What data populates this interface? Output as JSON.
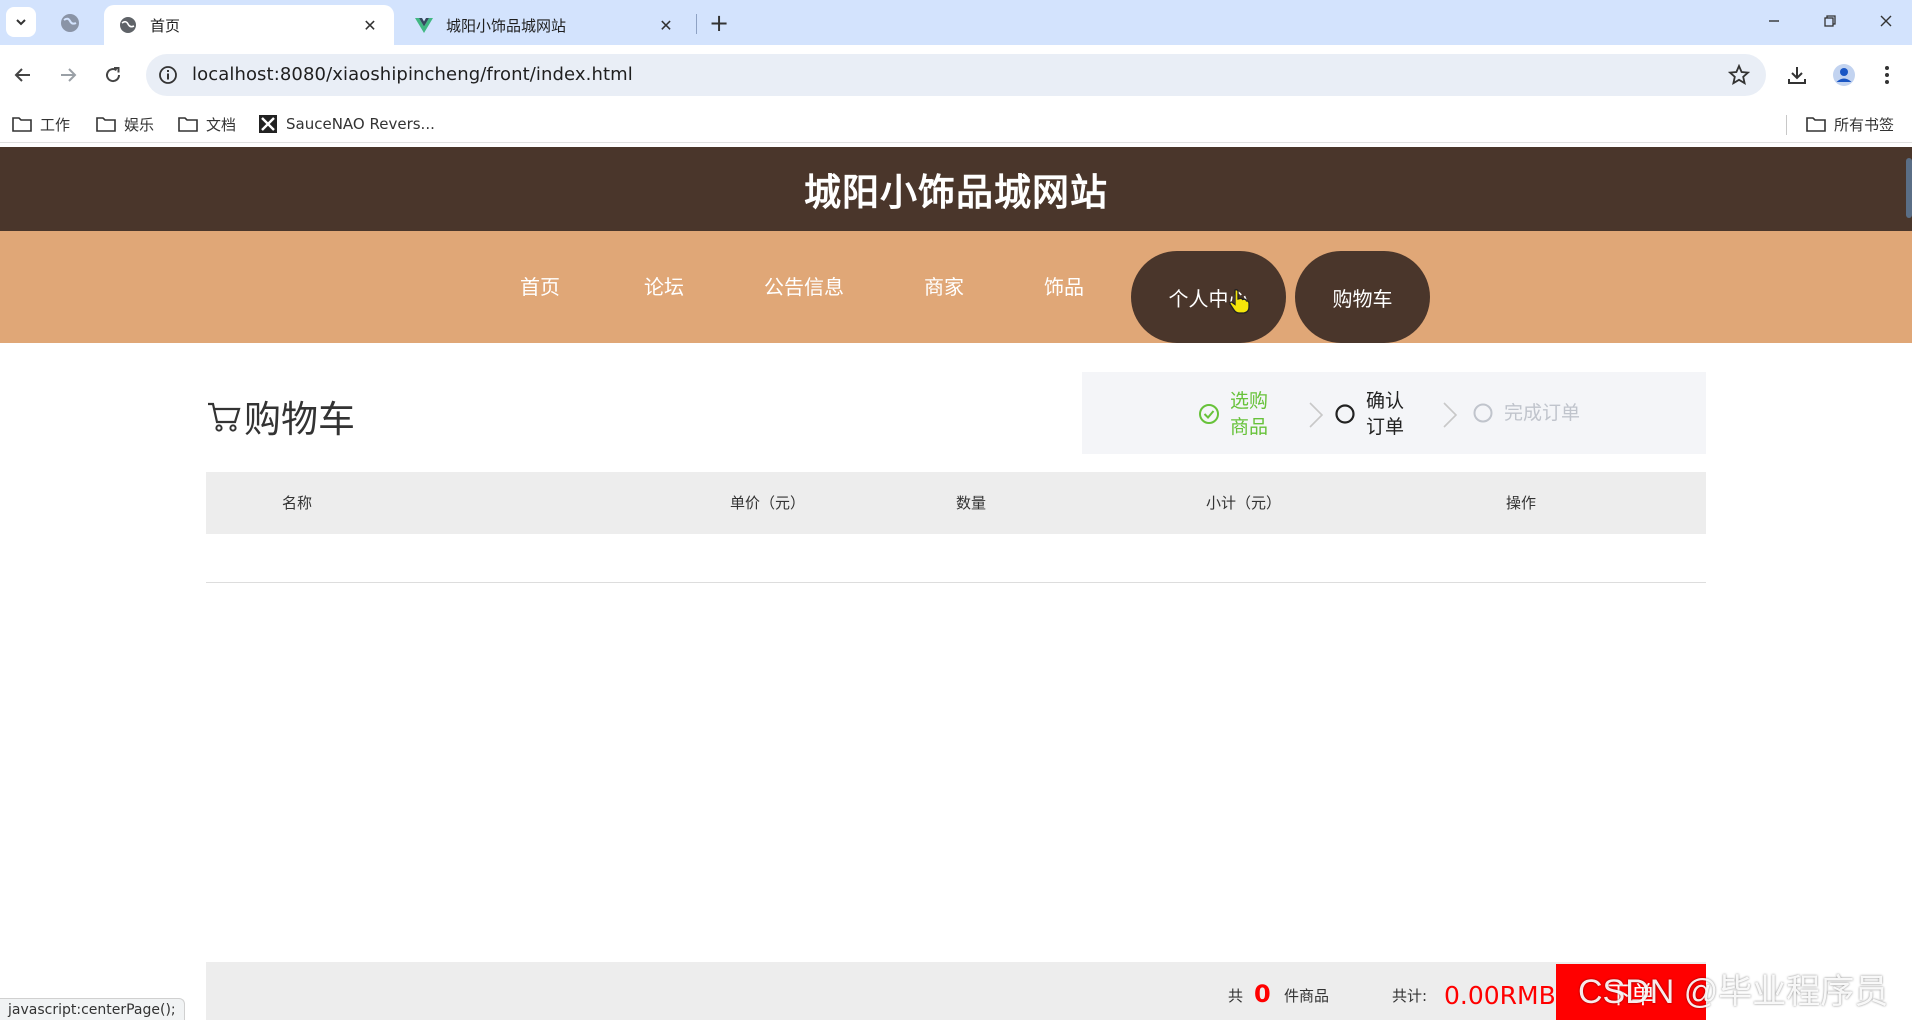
{
  "browser": {
    "tabs": [
      {
        "title": "首页",
        "active": true
      },
      {
        "title": "城阳小饰品城网站",
        "active": false
      }
    ],
    "url": "localhost:8080/xiaoshipincheng/front/index.html",
    "bookmarks": [
      {
        "label": "工作"
      },
      {
        "label": "娱乐"
      },
      {
        "label": "文档"
      },
      {
        "label": "SauceNAO Revers..."
      }
    ],
    "all_bookmarks_label": "所有书签",
    "status_text": "javascript:centerPage();"
  },
  "site": {
    "title": "城阳小饰品城网站",
    "nav": [
      "首页",
      "论坛",
      "公告信息",
      "商家",
      "饰品",
      "个人中心",
      "购物车"
    ],
    "accent_dark": "#4a362b",
    "accent_light": "#e0a777"
  },
  "cart": {
    "title": "购物车",
    "steps": [
      {
        "label": "选购商品",
        "state": "done"
      },
      {
        "label": "确认订单",
        "state": "current"
      },
      {
        "label": "完成订单",
        "state": "pending"
      }
    ],
    "columns": [
      "名称",
      "单价（元）",
      "数量",
      "小计（元）",
      "操作"
    ],
    "footer": {
      "count_prefix": "共",
      "count": "0",
      "count_suffix": "件商品",
      "total_label": "共计:",
      "total": "0.00RMB",
      "button_label": "下单"
    }
  },
  "watermark": "CSDN @毕业程序员"
}
